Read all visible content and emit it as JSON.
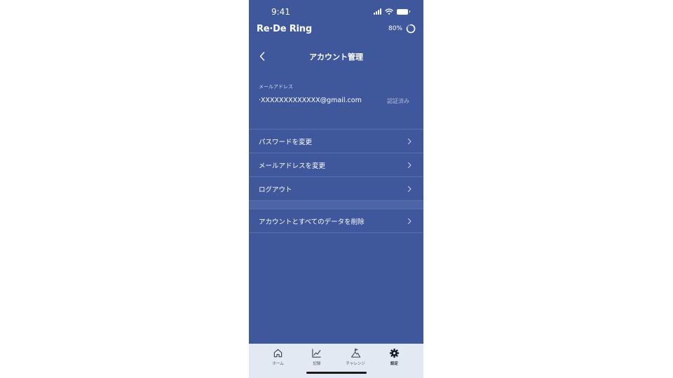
{
  "status_bar": {
    "time": "9:41"
  },
  "header": {
    "brand": "Re·De Ring",
    "ring_percent": "80%"
  },
  "nav": {
    "title": "アカウント管理"
  },
  "account": {
    "email_label": "メールアドレス",
    "email_value": "·XXXXXXXXXXXXX@gmail.com",
    "email_status": "認証済み"
  },
  "menu": {
    "items": [
      {
        "label": "パスワードを変更"
      },
      {
        "label": "メールアドレスを変更"
      },
      {
        "label": "ログアウト"
      },
      {
        "label": "アカウントとすべてのデータを削除"
      }
    ]
  },
  "tab_bar": {
    "items": [
      {
        "label": "ホーム",
        "icon": "home-icon"
      },
      {
        "label": "記録",
        "icon": "chart-icon"
      },
      {
        "label": "チャレンジ",
        "icon": "mountain-flag-icon"
      },
      {
        "label": "設定",
        "icon": "gear-icon"
      }
    ],
    "active": "設定"
  },
  "colors": {
    "background": "#3f589c",
    "tab_bar_background": "#e3e9f3",
    "divider": "#5b71ad"
  }
}
